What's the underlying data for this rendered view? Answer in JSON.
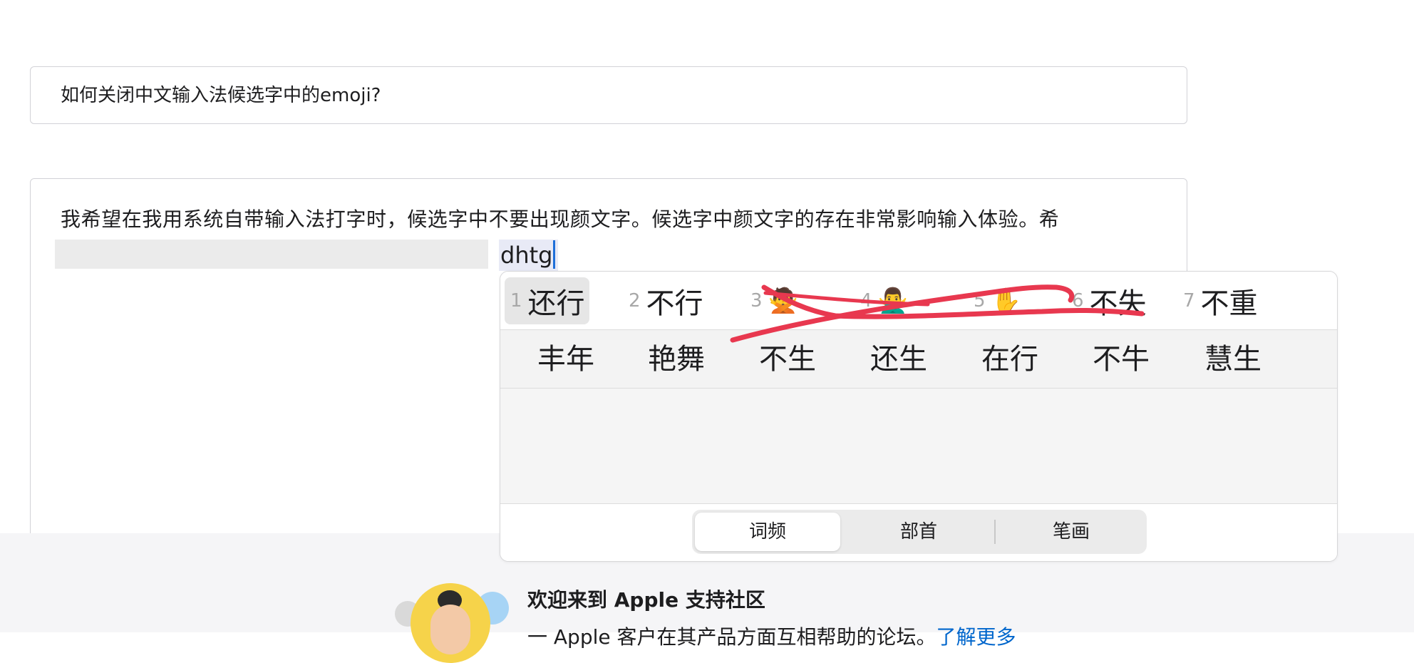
{
  "question": {
    "title": "如何关闭中文输入法候选字中的emoji?",
    "body_line1": "我希望在我用系统自带输入法打字时，候选字中不要出现颜文字。候选字中颜文字的存在非常影响输入体验。希",
    "composition": "dhtg"
  },
  "ime": {
    "row1": [
      {
        "num": "1",
        "text": "还行",
        "selected": true
      },
      {
        "num": "2",
        "text": "不行"
      },
      {
        "num": "3",
        "emoji": "🙅"
      },
      {
        "num": "4",
        "emoji": "🙅‍♂️"
      },
      {
        "num": "5",
        "emoji": "✋"
      },
      {
        "num": "6",
        "text": "不失"
      },
      {
        "num": "7",
        "text": "不重"
      }
    ],
    "row2": [
      "丰年",
      "艳舞",
      "不生",
      "还生",
      "在行",
      "不牛",
      "慧生"
    ],
    "sort_tabs": [
      "词频",
      "部首",
      "笔画"
    ],
    "active_tab": "词频",
    "annotation_color": "#e8384f"
  },
  "footer": {
    "heading": "欢迎来到 Apple 支持社区",
    "subtext": "一 Apple 客户在其产品方面互相帮助的论坛。",
    "link": "了解更多"
  }
}
